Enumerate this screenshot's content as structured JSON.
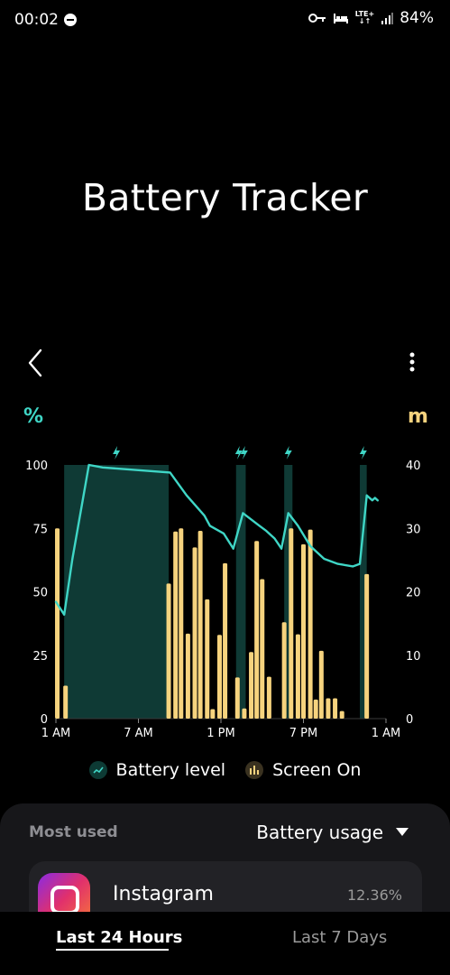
{
  "status": {
    "time": "00:02",
    "battery": "84%",
    "network": "LTE+"
  },
  "header": {
    "title": "Battery Tracker"
  },
  "chart_data": {
    "type": "bar+line",
    "left_unit": "%",
    "right_unit": "m",
    "left_ticks": [
      "100",
      "75",
      "50",
      "25",
      "0"
    ],
    "right_ticks": [
      "40",
      "30",
      "20",
      "10",
      "0"
    ],
    "x_ticks": [
      "1 AM",
      "7 AM",
      "1 PM",
      "7 PM",
      "1 AM"
    ],
    "ylim_left": [
      0,
      100
    ],
    "ylim_right": [
      0,
      40
    ],
    "xlim_hours": [
      0,
      24
    ],
    "charging_periods_hours": [
      [
        0.6,
        8.2
      ],
      [
        13.1,
        13.8
      ],
      [
        16.6,
        17.2
      ],
      [
        22.1,
        22.6
      ]
    ],
    "charging_bolt_hours": [
      4.4,
      13.3,
      16.9,
      22.35
    ],
    "battery_level": {
      "name": "Battery level",
      "x_hours": [
        0.0,
        0.6,
        1.2,
        2.4,
        3.4,
        8.3,
        9.5,
        10.8,
        11.2,
        12.2,
        12.9,
        13.6,
        14.8,
        15.3,
        15.9,
        16.4,
        16.9,
        17.6,
        18.5,
        19.5,
        20.5,
        21.6,
        22.1,
        22.6,
        23.0,
        23.2,
        23.4
      ],
      "values": [
        46,
        41,
        63,
        100,
        99,
        97,
        88,
        80,
        76,
        73,
        67,
        81,
        76,
        74,
        71,
        67,
        81,
        76,
        68,
        63,
        61,
        60,
        61,
        88,
        86,
        87,
        86
      ]
    },
    "screen_on": {
      "name": "Screen On",
      "unit": "m",
      "x_hours": [
        0.1,
        0.7,
        8.2,
        8.7,
        9.1,
        9.6,
        10.1,
        10.5,
        11.0,
        11.4,
        11.9,
        12.3,
        13.2,
        13.7,
        14.2,
        14.6,
        15.0,
        15.5,
        16.6,
        17.1,
        17.6,
        18.0,
        18.5,
        18.9,
        19.3,
        19.8,
        20.3,
        20.8,
        21.3,
        22.6
      ],
      "values": [
        30,
        5.2,
        21.3,
        29.5,
        30,
        13.4,
        27,
        29.6,
        18.8,
        1.5,
        13.2,
        24.5,
        6.5,
        1.6,
        10.5,
        28,
        22,
        6.6,
        15.2,
        30,
        13.3,
        27.5,
        29.8,
        3,
        10.7,
        3.2,
        3.2,
        1.2,
        0,
        22.8
      ]
    }
  },
  "legend": {
    "battery_label": "Battery level",
    "screen_label": "Screen On"
  },
  "panel": {
    "section_label": "Most used",
    "sort_label": "Battery usage",
    "app_name": "Instagram",
    "app_percent": "12.36%"
  },
  "tabs": {
    "tab1": "Last 24 Hours",
    "tab2": "Last 7 Days"
  },
  "colors": {
    "accent_teal": "#3fd6c6",
    "bar_yellow": "#f6d37e",
    "charging_band": "#0f3a35",
    "background": "#000000",
    "panel": "#17171a"
  }
}
